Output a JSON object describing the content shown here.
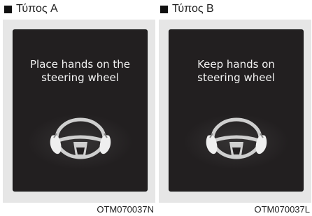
{
  "panels": [
    {
      "title": "Τύπος A",
      "message": "Place hands on the\nsteering wheel",
      "code": "OTM070037N"
    },
    {
      "title": "Τύπος B",
      "message": "Keep hands on\nsteering wheel",
      "code": "OTM070037L"
    }
  ],
  "colors": {
    "screen_bg": "#221f20",
    "frame_bg": "#e6e6e6",
    "text_on_screen": "#f2f2f2"
  },
  "icons": [
    "steering-wheel-icon",
    "hands-on-wheel-icon"
  ]
}
